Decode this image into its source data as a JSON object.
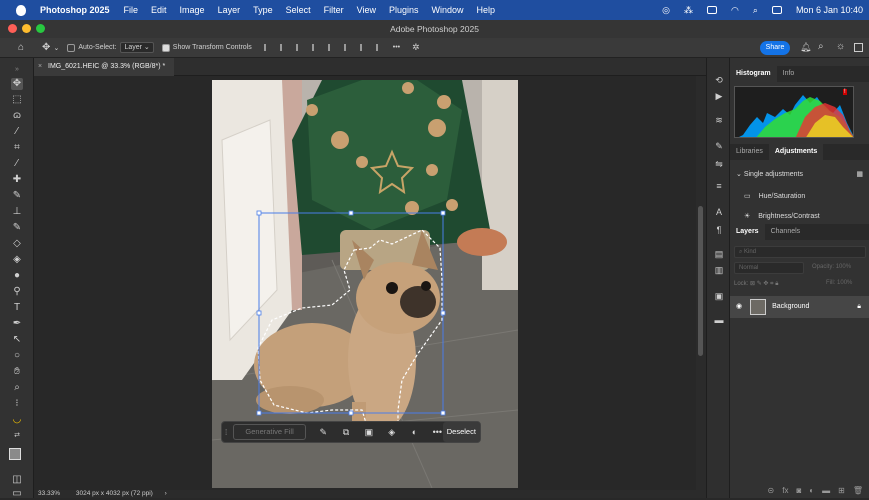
{
  "menubar": {
    "app_name": "Photoshop 2025",
    "menus": [
      "File",
      "Edit",
      "Image",
      "Layer",
      "Type",
      "Select",
      "Filter",
      "View",
      "Plugins",
      "Window",
      "Help"
    ],
    "clock": "Mon 6 Jan 10:40"
  },
  "window": {
    "title": "Adobe Photoshop 2025"
  },
  "options_bar": {
    "auto_select_label": "Auto-Select:",
    "auto_select_value": "Layer",
    "show_transform_label": "Show Transform Controls",
    "share_label": "Share"
  },
  "document": {
    "tab_label": "IMG_6021.HEIC @ 33.3% (RGB/8*) *",
    "zoom": "33.33%",
    "dimensions": "3024 px x 4032 px (72 ppi)"
  },
  "context_bar": {
    "generative_fill": "Generative Fill",
    "deselect": "Deselect"
  },
  "panels": {
    "top_tabs": [
      "Histogram",
      "Info"
    ],
    "mid_tabs": [
      "Libraries",
      "Adjustments"
    ],
    "adjustments_header": "Single adjustments",
    "adjustments": [
      "Hue/Saturation",
      "Brightness/Contrast"
    ],
    "layer_tabs": [
      "Layers",
      "Channels"
    ],
    "layers_filter_placeholder": "Kind",
    "blend_mode": "Normal",
    "opacity_label": "Opacity:",
    "opacity_value": "100%",
    "lock_label": "Lock:",
    "fill_label": "Fill:",
    "fill_value": "100%",
    "layer_name": "Background"
  },
  "colors": {
    "menubar": "#1f4ea0",
    "accent": "#1473e6",
    "panel": "#323232",
    "canvas": "#282828"
  }
}
